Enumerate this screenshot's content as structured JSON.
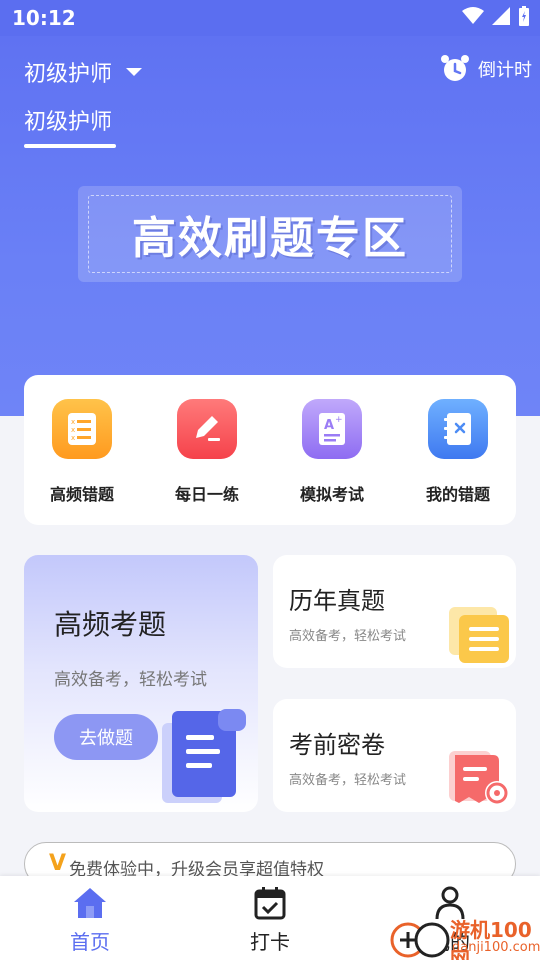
{
  "status_bar": {
    "time": "10:12"
  },
  "header": {
    "exam_selector": "初级护师",
    "countdown_label": "倒计时",
    "active_tab": "初级护师"
  },
  "banner": {
    "text": "高效刷题专区"
  },
  "quick_actions": [
    {
      "label": "高频错题",
      "icon": "list-checks-icon",
      "color": "#ffa62b"
    },
    {
      "label": "每日一练",
      "icon": "edit-pencil-icon",
      "color": "#f6555d"
    },
    {
      "label": "模拟考试",
      "icon": "exam-paper-icon",
      "color": "#a68af7"
    },
    {
      "label": "我的错题",
      "icon": "notebook-x-icon",
      "color": "#4c8cf5"
    }
  ],
  "feature_cards": {
    "high_freq": {
      "title": "高频考题",
      "subtitle": "高效备考，轻松考试",
      "button": "去做题"
    },
    "past_papers": {
      "title": "历年真题",
      "subtitle": "高效备考，轻松考试"
    },
    "secret_paper": {
      "title": "考前密卷",
      "subtitle": "高效备考，轻松考试"
    }
  },
  "vip_bar": {
    "prefix": "V",
    "text": "免费体验中，升级会员享超值特权"
  },
  "bottom_nav": [
    {
      "label": "首页",
      "icon": "home-icon",
      "active": true
    },
    {
      "label": "打卡",
      "icon": "calendar-check-icon",
      "active": false
    },
    {
      "label": "我的",
      "icon": "user-icon",
      "active": false
    }
  ],
  "watermark": {
    "line1": "游机100网",
    "line2": "danji100.com"
  },
  "colors": {
    "primary": "#5f72f2",
    "accent_active": "#5b6ef0",
    "vip": "#f4a21c"
  }
}
